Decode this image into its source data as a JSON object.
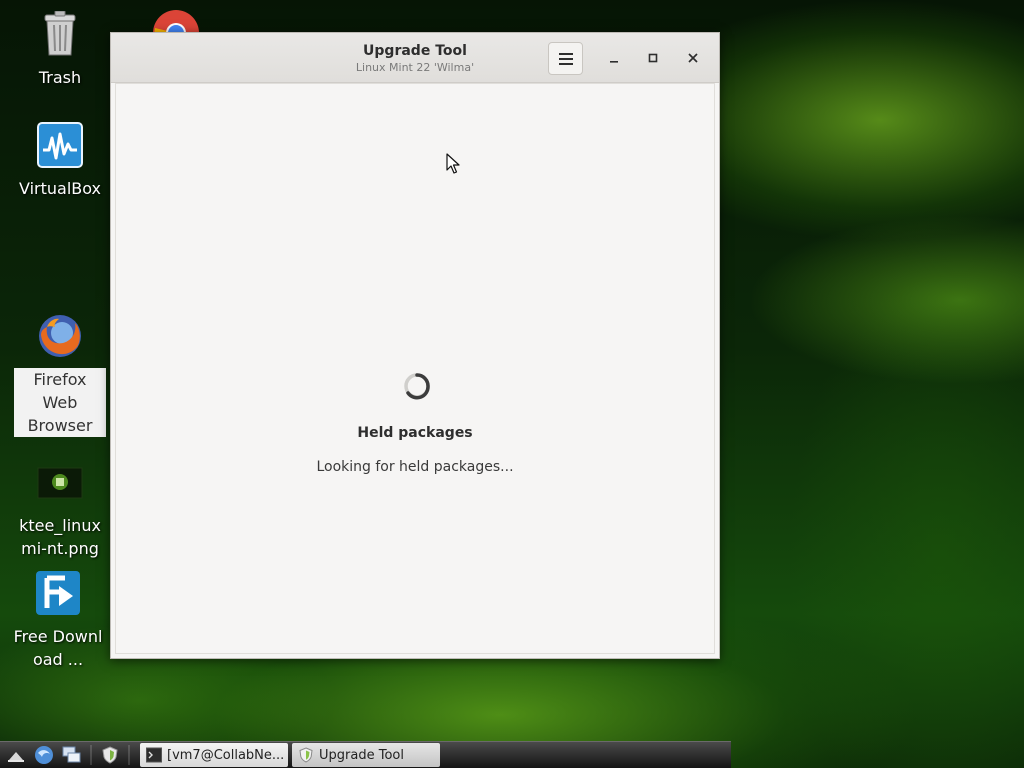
{
  "desktop": {
    "icons": [
      {
        "label": "Trash",
        "icon": "trash-icon"
      },
      {
        "label": "VirtualBox",
        "icon": "virtualbox-icon"
      },
      {
        "label": "Firefox Web Browser",
        "icon": "firefox-icon"
      },
      {
        "label": "ktee_linuxmi-nt.png",
        "icon": "image-file-icon"
      },
      {
        "label": "Free Download ...",
        "icon": "free-download-manager-icon"
      }
    ],
    "partial_icon": "chrome-icon"
  },
  "window": {
    "title": "Upgrade Tool",
    "subtitle": "Linux Mint 22 'Wilma'",
    "menu_icon": "hamburger-menu-icon",
    "buttons": [
      "minimize-icon",
      "maximize-icon",
      "close-icon"
    ],
    "status_title": "Held packages",
    "status_text": "Looking for held packages..."
  },
  "taskbar": {
    "launchers": [
      "show-desktop-icon",
      "web-browser-icon",
      "window-switcher-icon",
      "mintupdate-shield-icon"
    ],
    "tasks": [
      {
        "label": "[vm7@CollabNe...",
        "icon": "terminal-icon"
      },
      {
        "label": "Upgrade Tool",
        "icon": "mint-shield-icon"
      }
    ]
  },
  "colors": {
    "window_bg": "#f6f5f4",
    "titlebar_bg": "#e3e1de",
    "taskbar_bg": "#2a2a2a",
    "wallpaper_accent": "#6fcf1e"
  }
}
